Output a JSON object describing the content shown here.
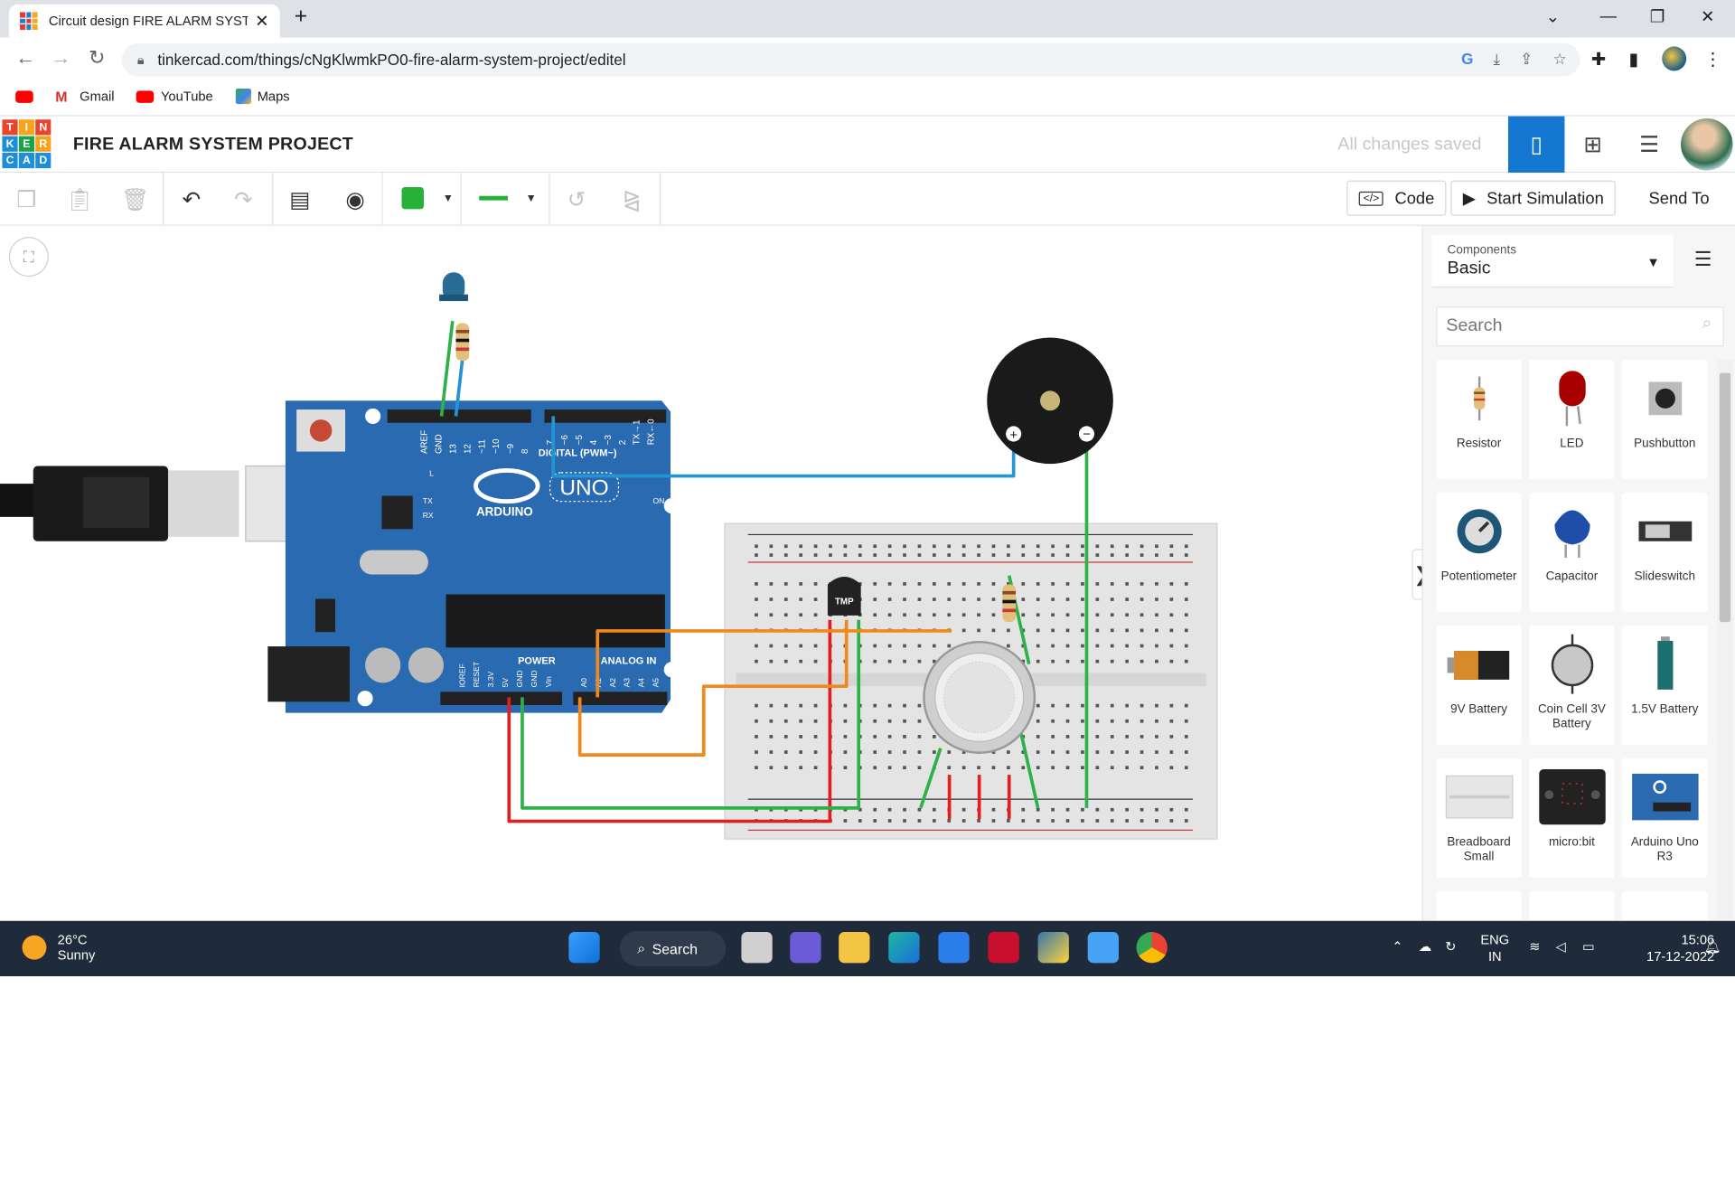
{
  "browser": {
    "tab_title": "Circuit design FIRE ALARM SYSTE",
    "url": "tinkercad.com/things/cNgKlwmkPO0-fire-alarm-system-project/editel",
    "bookmarks": [
      "Gmail",
      "YouTube",
      "Maps"
    ]
  },
  "header": {
    "logo_letters": [
      "T",
      "I",
      "N",
      "K",
      "E",
      "R",
      "C",
      "A",
      "D"
    ],
    "project_title": "FIRE ALARM SYSTEM PROJECT",
    "save_status": "All changes saved"
  },
  "toolbar": {
    "code_label": "Code",
    "start_sim_label": "Start Simulation",
    "send_to_label": "Send To",
    "wire_color": "#26b23a"
  },
  "circuit": {
    "arduino_brand": "ARDUINO",
    "arduino_model": "UNO",
    "digital_label": "DIGITAL (PWM~)",
    "power_label": "POWER",
    "analog_label": "ANALOG IN",
    "on_label": "ON",
    "tmp_label": "TMP",
    "pin_labels_top": [
      "AREF",
      "GND",
      "13",
      "12",
      "~11",
      "~10",
      "~9",
      "8",
      "7",
      "~6",
      "~5",
      "4",
      "~3",
      "2",
      "TX→1",
      "RX←0"
    ],
    "pin_labels_bottom": [
      "IOREF",
      "RESET",
      "3.3V",
      "5V",
      "GND",
      "GND",
      "Vin",
      "A0",
      "A1",
      "A2",
      "A3",
      "A4",
      "A5"
    ],
    "tx_label": "TX",
    "rx_label": "RX",
    "l_label": "L"
  },
  "panel": {
    "components_label": "Components",
    "components_value": "Basic",
    "search_placeholder": "Search",
    "components": [
      "Resistor",
      "LED",
      "Pushbutton",
      "Potentiometer",
      "Capacitor",
      "Slideswitch",
      "9V Battery",
      "Coin Cell 3V Battery",
      "1.5V Battery",
      "Breadboard Small",
      "micro:bit",
      "Arduino Uno R3"
    ]
  },
  "taskbar": {
    "temperature": "26°C",
    "weather": "Sunny",
    "search_label": "Search",
    "lang": "ENG",
    "region": "IN",
    "time": "15:06",
    "date": "17-12-2022"
  }
}
